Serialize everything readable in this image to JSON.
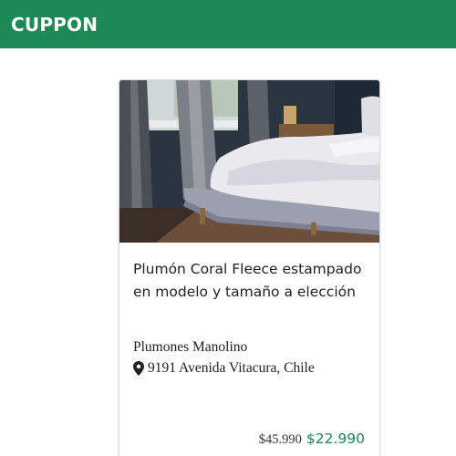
{
  "header": {
    "brand": "CUPPON",
    "brand_color": "#1d8a55"
  },
  "deal": {
    "image_icon": "bedroom-photo",
    "title": "Plumón Coral Fleece estampado en modelo y tamaño a elección",
    "merchant": "Plumones Manolino",
    "location_icon": "map-pin-icon",
    "address": "9191 Avenida Vitacura, Chile",
    "original_price": "$45.990",
    "sale_price": "$22.990",
    "sale_price_color": "#1d8a55"
  }
}
